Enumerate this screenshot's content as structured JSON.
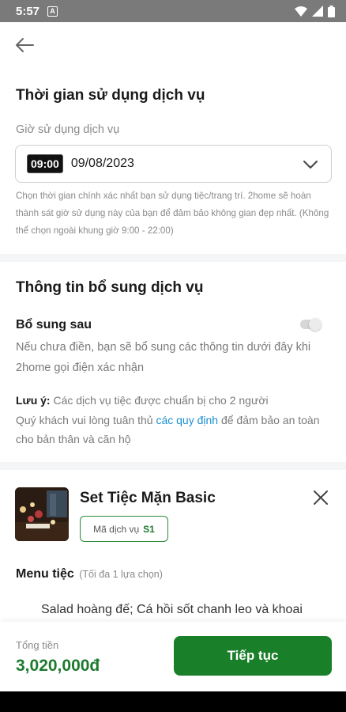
{
  "status_bar": {
    "time": "5:57",
    "notif_icon": "A"
  },
  "header": {
    "back_icon": "back-arrow-icon"
  },
  "service_time": {
    "title": "Thời gian sử dụng dịch vụ",
    "field_label": "Giờ sử dụng dịch vụ",
    "time": "09:00",
    "date": "09/08/2023",
    "hint": "Chọn thời gian chính xác nhất bạn sử dụng tiệc/trang trí. 2home sẽ hoàn thành sát giờ sử dụng này của bạn để đảm bảo không gian đẹp nhất. (Không thể chọn ngoài khung giờ 9:00 - 22:00)"
  },
  "additional_info": {
    "title": "Thông tin bổ sung dịch vụ",
    "supplement_label": "Bổ sung sau",
    "supplement_desc": "Nếu chưa điền, bạn sẽ bổ sung các thông tin dưới đây khi 2home gọi điện xác nhận",
    "note_label": "Lưu ý:",
    "note_line1": "Các dịch vụ tiệc được chuẩn bị cho 2 người",
    "note_line2_pre": "Quý khách vui lòng tuân thủ",
    "note_link": "các quy định",
    "note_line2_post": "để đảm bảo an toàn cho bản thân và căn hộ"
  },
  "product": {
    "name": "Set Tiệc Mặn Basic",
    "code_label": "Mã dịch vụ",
    "code": "S1",
    "menu_title": "Menu tiệc",
    "menu_sub": "(Tối đa 1 lựa chọn)",
    "menu_items": "Salad hoàng đế; Cá hồi sốt chanh leo và khoai"
  },
  "footer": {
    "total_label": "Tổng tiền",
    "total_value": "3,020,000đ",
    "continue_label": "Tiếp tục"
  },
  "colors": {
    "primary": "#1a7f29",
    "link": "#1a8fd0",
    "price": "#1e7a2e"
  }
}
